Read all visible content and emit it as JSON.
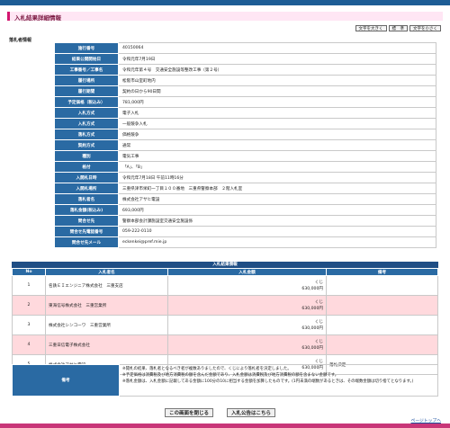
{
  "header": {
    "title": "入札結果詳細情報"
  },
  "font_buttons": [
    "文字を大きく",
    "標　準",
    "文字を小さく"
  ],
  "section_label": "落札者情報",
  "info_rows": [
    {
      "label": "施行番号",
      "value": "40150064"
    },
    {
      "label": "結果公開開始日",
      "value": "令和元年7月19日"
    },
    {
      "label": "工事番号／工事名",
      "value": "令和元年第４号　交通安全施設等整改工事（第２号）"
    },
    {
      "label": "履行場所",
      "value": "松阪市山室町地内"
    },
    {
      "label": "履行期間",
      "value": "契約の日から90日間"
    },
    {
      "label": "予定価格（税込み）",
      "value": "781,000円"
    },
    {
      "label": "入札方式",
      "value": "電子入札"
    },
    {
      "label": "入札方式",
      "value": "一般競争入札"
    },
    {
      "label": "落札方式",
      "value": "価格競争"
    },
    {
      "label": "契約方式",
      "value": "通常"
    },
    {
      "label": "種別",
      "value": "電気工事"
    },
    {
      "label": "格付",
      "value": "「A」、「B」"
    },
    {
      "label": "入開札日時",
      "value": "令和元年7月18日 午前11時16分"
    },
    {
      "label": "入開札場所",
      "value": "三重県津市栄町一丁目１００番地　三重県警察本部　２階入札室"
    },
    {
      "label": "落札者名",
      "value": "株式会社アサヒ電設"
    },
    {
      "label": "落札金額(税込み)",
      "value": "693,000円"
    },
    {
      "label": "問合せ先",
      "value": "警察本部会計課施設室交通安全施設係"
    },
    {
      "label": "問合せ先電話番号",
      "value": "059-222-0110"
    },
    {
      "label": "問合せ先メール",
      "value": "eckenkei@pref.mie.jp"
    }
  ],
  "results": {
    "heading": "入札結果情報",
    "columns": [
      "No",
      "入札者名",
      "入札金額",
      "備考"
    ],
    "rows": [
      {
        "no": "1",
        "name": "名鉄ＥＩエンジニア株式会社　三重支店",
        "note1": "くじ",
        "amount": "630,000円",
        "remark": ""
      },
      {
        "no": "2",
        "name": "東海信号株式会社　三重営業所",
        "note1": "くじ",
        "amount": "630,000円",
        "remark": ""
      },
      {
        "no": "3",
        "name": "株式会社シンコーワ　三重営業所",
        "note1": "くじ",
        "amount": "630,000円",
        "remark": ""
      },
      {
        "no": "4",
        "name": "三重日信電子株式会社",
        "note1": "くじ",
        "amount": "630,000円",
        "remark": ""
      },
      {
        "no": "5",
        "name": "株式会社アサヒ電設",
        "note1": "くじ",
        "amount": "630,000円",
        "remark": "落札決定"
      }
    ]
  },
  "notes": {
    "label": "備考",
    "lines": [
      "※開札の結果、落札者となるべき者が複数ありましたので、くじにより落札者を決定しました。",
      "※予定価格は消費税及び地方消費税の額を含んだ金額であり、入札金額は消費税及び地方消費税の額を含まない金額です。",
      "※落札金額は、入札金額に記載してある金額に100分の10に相当する金額を加算したものです。(1円未満の端数があるときは、その端数金額は切り捨てとなります。)"
    ]
  },
  "buttons": {
    "close": "この画面を閉じる",
    "notice": "入札公告はこちら"
  },
  "page_top": "ページトップへ"
}
